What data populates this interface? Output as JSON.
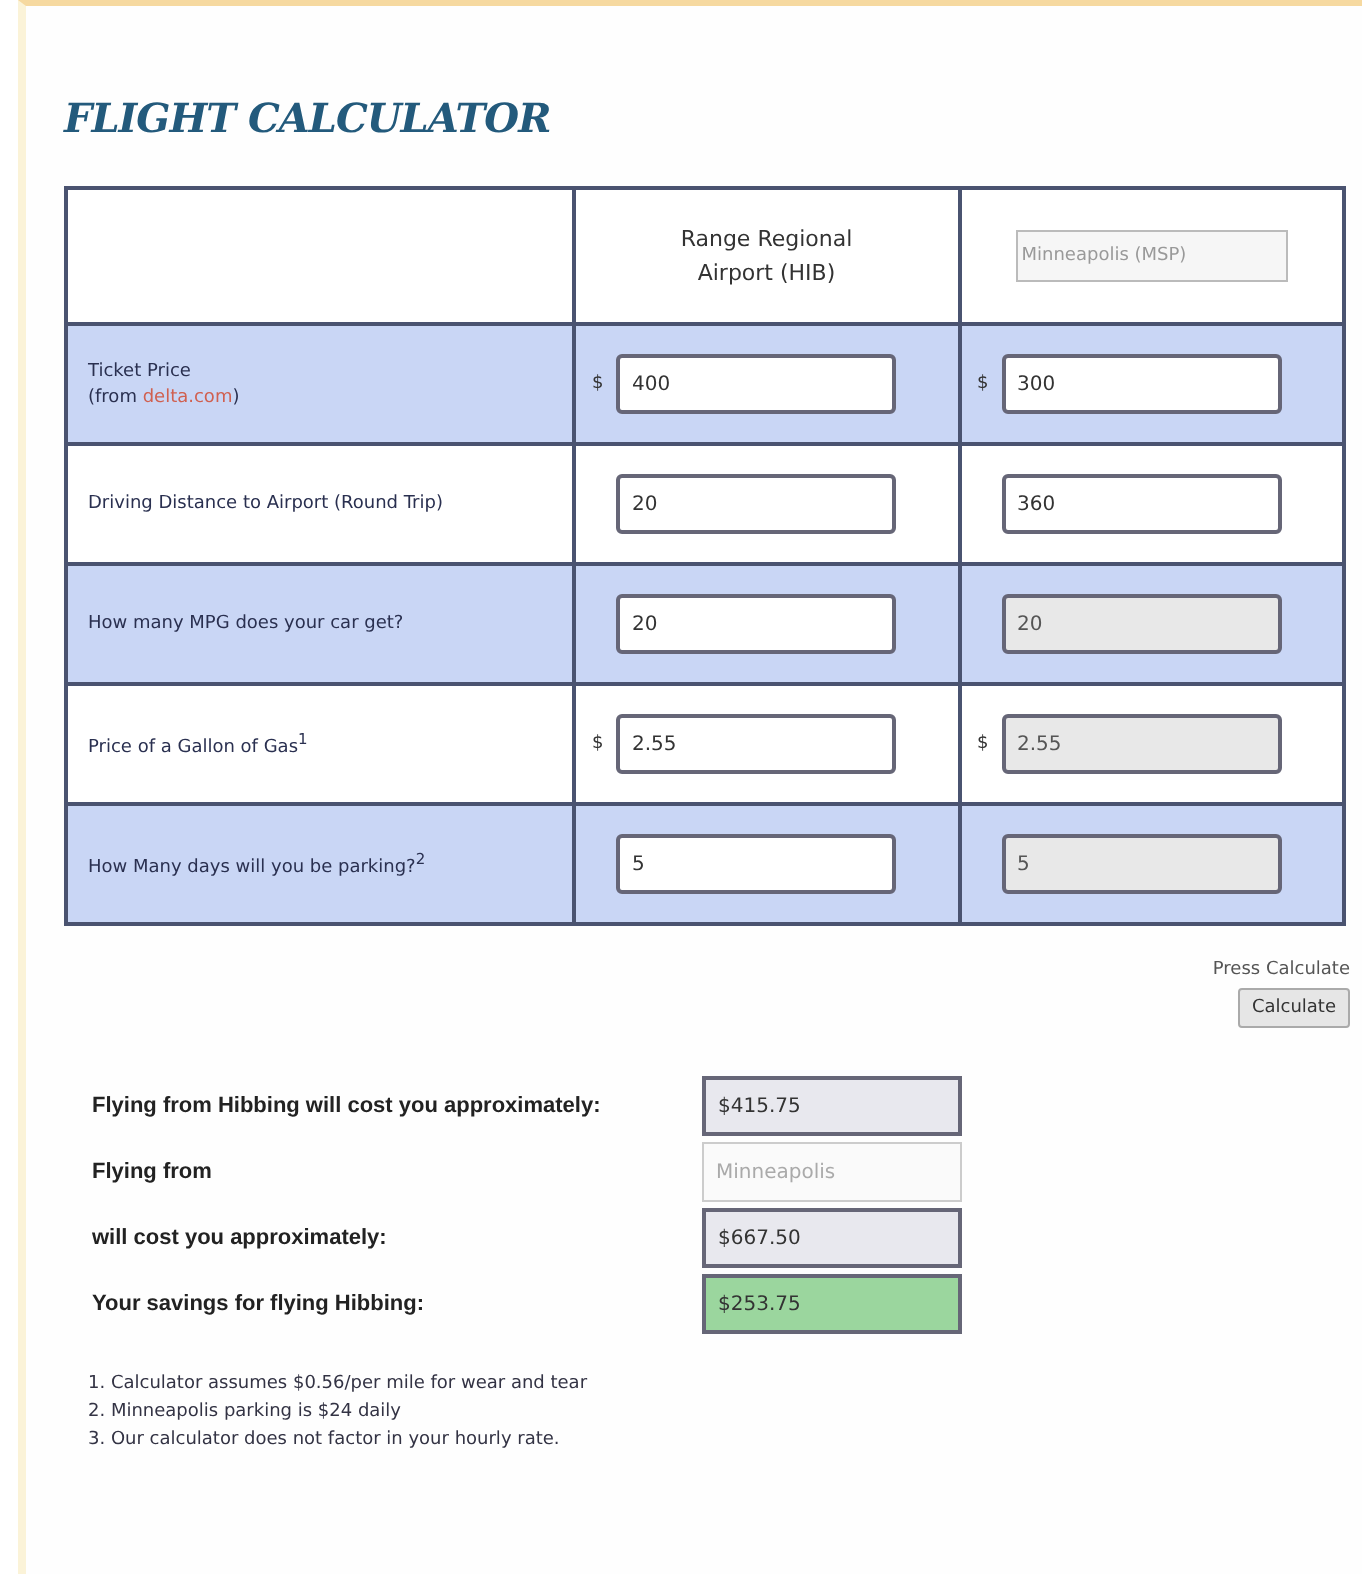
{
  "title": "FLIGHT CALCULATOR",
  "table": {
    "columns": [
      {
        "label": "Range Regional Airport (HIB)",
        "kind": "text"
      },
      {
        "label": "Minneapolis (MSP)",
        "kind": "field",
        "disabled": true
      }
    ],
    "rows": [
      {
        "label": "Ticket Price",
        "note": "(from ",
        "link": "delta.com",
        "note_end": ")",
        "shaded": true,
        "prefix": "$",
        "values": [
          {
            "value": "400",
            "disabled": false
          },
          {
            "value": "300",
            "disabled": false
          }
        ]
      },
      {
        "label": "Driving Distance to Airport (Round Trip)",
        "shaded": false,
        "values": [
          {
            "value": "20",
            "disabled": false
          },
          {
            "value": "360",
            "disabled": false
          }
        ]
      },
      {
        "label": "How many MPG does your car get?",
        "shaded": true,
        "values": [
          {
            "value": "20",
            "disabled": false
          },
          {
            "value": "20",
            "disabled": true
          }
        ]
      },
      {
        "label": "Price of a Gallon of Gas$^{1}$",
        "shaded": false,
        "prefix": "$",
        "values": [
          {
            "value": "2.55",
            "disabled": false
          },
          {
            "value": "2.55",
            "disabled": true
          }
        ]
      },
      {
        "label": "How Many days will you be parking?$^{2}$",
        "shaded": true,
        "values": [
          {
            "value": "5",
            "disabled": false
          },
          {
            "value": "5",
            "disabled": true
          }
        ]
      }
    ]
  },
  "calculate": {
    "prompt": "Press Calculate",
    "button": "Calculate"
  },
  "results": [
    {
      "label": "Flying from Hibbing will cost you approximately:",
      "value": "$415.75",
      "kind": "readonly"
    },
    {
      "label": "Flying from",
      "placeholder": "Minneapolis",
      "kind": "disabled"
    },
    {
      "label": "will cost you approximately:",
      "value": "$667.50",
      "kind": "readonly"
    },
    {
      "label": "Your savings for flying Hibbing:",
      "value": "$253.75",
      "kind": "savings"
    }
  ],
  "footnotes": [
    "1. Calculator assumes $0.56/per mile for wear and tear",
    "2. Minneapolis parking is $24 daily",
    "3. Our calculator does not factor in your hourly rate."
  ]
}
